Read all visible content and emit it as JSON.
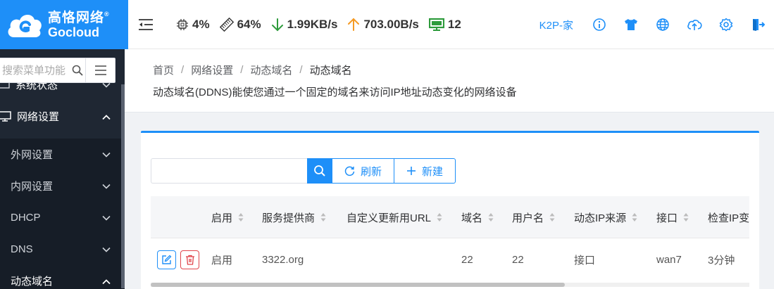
{
  "brand": {
    "name_cn": "高恪网络",
    "name_en": "Gocloud",
    "reg": "®"
  },
  "topbar": {
    "cpu": "4%",
    "memory": "64%",
    "download": "1.99KB/s",
    "upload": "703.00B/s",
    "clients": "12",
    "device_name": "K2P-家",
    "icons": [
      "info-icon",
      "tshirt-icon",
      "globe-icon",
      "cloud-upload-icon",
      "gear-icon",
      "logout-icon"
    ]
  },
  "sidebar": {
    "search_placeholder": "搜索菜单功能",
    "items": [
      {
        "label": "系统状态"
      },
      {
        "label": "网络设置"
      },
      {
        "label": "外网设置"
      },
      {
        "label": "内网设置"
      },
      {
        "label": "DHCP"
      },
      {
        "label": "DNS"
      },
      {
        "label": "动态域名"
      }
    ]
  },
  "breadcrumb": [
    "首页",
    "网络设置",
    "动态域名",
    "动态域名"
  ],
  "description": "动态域名(DDNS)能使您通过一个固定的域名来访问IP地址动态变化的网络设备",
  "toolbar": {
    "search_value": "",
    "refresh_label": "刷新",
    "new_label": "新建"
  },
  "table": {
    "columns": [
      "启用",
      "服务提供商",
      "自定义更新用URL",
      "域名",
      "用户名",
      "动态IP来源",
      "接口",
      "检查IP变"
    ],
    "rows": [
      {
        "enabled": "启用",
        "provider": "3322.org",
        "url": "",
        "domain": "22",
        "username": "22",
        "ip_source": "接口",
        "interface": "wan7",
        "check": "3分钟"
      }
    ]
  },
  "colors": {
    "primary": "#1e8ff8",
    "sidebar_bg": "#1f2733",
    "danger": "#e0454b",
    "download": "#2e9b3c",
    "upload": "#f59a23",
    "clients": "#2e9b3c"
  }
}
